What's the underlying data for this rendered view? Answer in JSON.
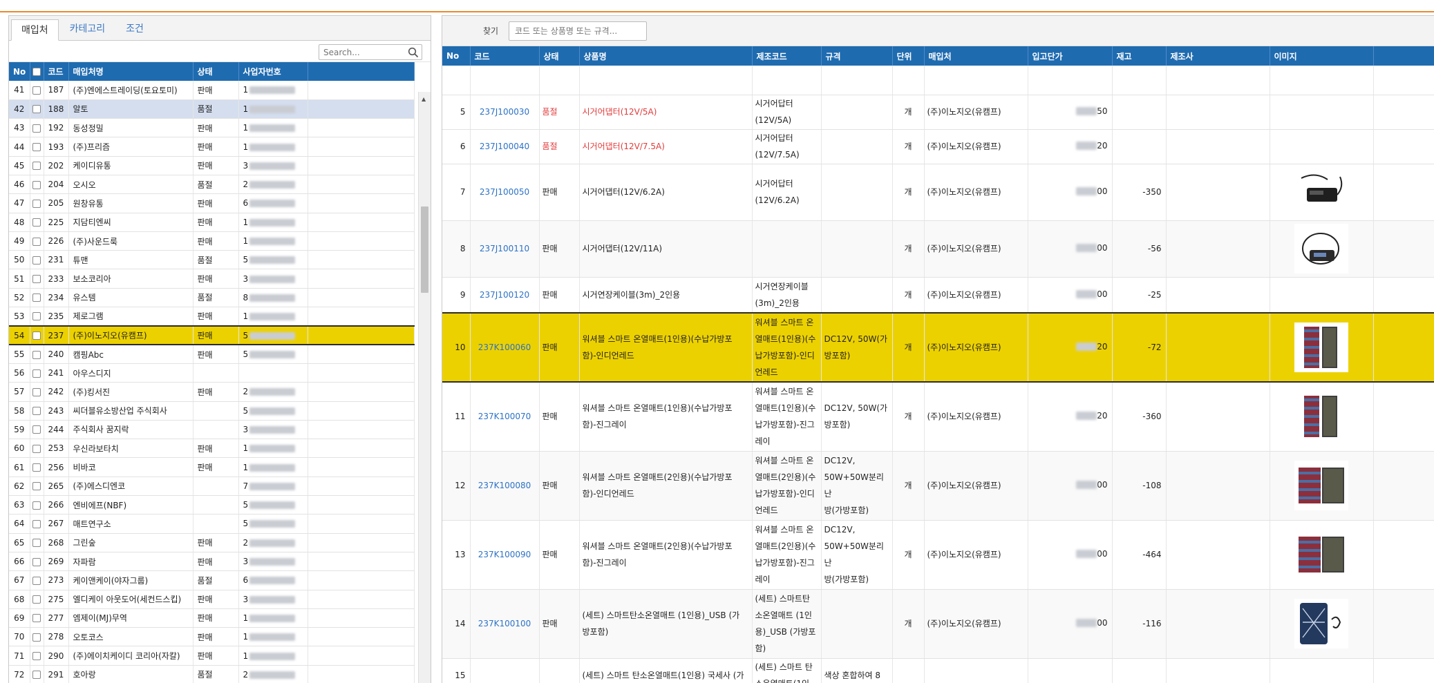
{
  "left": {
    "tabs": [
      "매입처",
      "카테고리",
      "조건"
    ],
    "search_placeholder": "Search...",
    "headers": [
      "No",
      "",
      "코드",
      "매입처명",
      "상태",
      "사업자번호"
    ],
    "rows": [
      {
        "no": "41",
        "code": "187",
        "name": "(주)엔에스트레이딩(토요토미)",
        "status": "판매",
        "biz": "1"
      },
      {
        "no": "42",
        "code": "188",
        "name": "알토",
        "status": "품절",
        "biz": "1"
      },
      {
        "no": "43",
        "code": "192",
        "name": "동성정밀",
        "status": "판매",
        "biz": "1"
      },
      {
        "no": "44",
        "code": "193",
        "name": "(주)프리즘",
        "status": "판매",
        "biz": "1"
      },
      {
        "no": "45",
        "code": "202",
        "name": "케이디유통",
        "status": "판매",
        "biz": "3"
      },
      {
        "no": "46",
        "code": "204",
        "name": "오시오",
        "status": "품절",
        "biz": "2"
      },
      {
        "no": "47",
        "code": "205",
        "name": "원창유통",
        "status": "판매",
        "biz": "6"
      },
      {
        "no": "48",
        "code": "225",
        "name": "지담티엔씨",
        "status": "판매",
        "biz": "1"
      },
      {
        "no": "49",
        "code": "226",
        "name": "(주)사운드룩",
        "status": "판매",
        "biz": "1"
      },
      {
        "no": "50",
        "code": "231",
        "name": "튜맨",
        "status": "품절",
        "biz": "5"
      },
      {
        "no": "51",
        "code": "233",
        "name": "보소코리아",
        "status": "판매",
        "biz": "3"
      },
      {
        "no": "52",
        "code": "234",
        "name": "유스템",
        "status": "품절",
        "biz": "8"
      },
      {
        "no": "53",
        "code": "235",
        "name": "제로그램",
        "status": "판매",
        "biz": "1"
      },
      {
        "no": "54",
        "code": "237",
        "name": "(주)이노지오(유캠프)",
        "status": "판매",
        "biz": "5"
      },
      {
        "no": "55",
        "code": "240",
        "name": "캠핑Abc",
        "status": "판매",
        "biz": "5"
      },
      {
        "no": "56",
        "code": "241",
        "name": "아우스디지",
        "status": "",
        "biz": ""
      },
      {
        "no": "57",
        "code": "242",
        "name": "(주)킹서진",
        "status": "판매",
        "biz": "2"
      },
      {
        "no": "58",
        "code": "243",
        "name": "씨더블유소방산업 주식회사",
        "status": "",
        "biz": "5"
      },
      {
        "no": "59",
        "code": "244",
        "name": "주식회사 꿈지락",
        "status": "",
        "biz": "3"
      },
      {
        "no": "60",
        "code": "253",
        "name": "우신라보타치",
        "status": "판매",
        "biz": "1"
      },
      {
        "no": "61",
        "code": "256",
        "name": "비바코",
        "status": "판매",
        "biz": "1"
      },
      {
        "no": "62",
        "code": "265",
        "name": "(주)에스디엔코",
        "status": "",
        "biz": "7"
      },
      {
        "no": "63",
        "code": "266",
        "name": "엔비에프(NBF)",
        "status": "",
        "biz": "5"
      },
      {
        "no": "64",
        "code": "267",
        "name": "매트연구소",
        "status": "",
        "biz": "5"
      },
      {
        "no": "65",
        "code": "268",
        "name": "그린숲",
        "status": "판매",
        "biz": "2"
      },
      {
        "no": "66",
        "code": "269",
        "name": "자파람",
        "status": "판매",
        "biz": "3"
      },
      {
        "no": "67",
        "code": "273",
        "name": "케이앤케이(야자그룹)",
        "status": "품절",
        "biz": "6"
      },
      {
        "no": "68",
        "code": "275",
        "name": "엘디케이 아웃도어(세컨드스킵)",
        "status": "판매",
        "biz": "3"
      },
      {
        "no": "69",
        "code": "277",
        "name": "엠제이(MJ)무역",
        "status": "판매",
        "biz": "1"
      },
      {
        "no": "70",
        "code": "278",
        "name": "오토코스",
        "status": "판매",
        "biz": "1"
      },
      {
        "no": "71",
        "code": "290",
        "name": "(주)에이치케이디 코리아(자칼)",
        "status": "판매",
        "biz": "1"
      },
      {
        "no": "72",
        "code": "291",
        "name": "호아랑",
        "status": "품절",
        "biz": "2"
      }
    ]
  },
  "right": {
    "find_label": "찾기",
    "find_placeholder": "코드 또는 상품명 또는 규격...",
    "headers": [
      "No",
      "코드",
      "상태",
      "상품명",
      "제조코드",
      "규격",
      "단위",
      "매입처",
      "입고단가",
      "재고",
      "제조사",
      "이미지"
    ],
    "rows": [
      {
        "no": "5",
        "code": "237J100030",
        "status": "품절",
        "name": "시거어댑터(12V/5A)",
        "mcode": "시거어답터\n(12V/5A)",
        "spec": "",
        "unit": "개",
        "vendor": "(주)이노지오(유캠프)",
        "price": "50",
        "stock": "",
        "maker": ""
      },
      {
        "no": "6",
        "code": "237J100040",
        "status": "품절",
        "name": "시거어댑터(12V/7.5A)",
        "mcode": "시거어답터\n(12V/7.5A)",
        "spec": "",
        "unit": "개",
        "vendor": "(주)이노지오(유캠프)",
        "price": "20",
        "stock": "",
        "maker": ""
      },
      {
        "no": "7",
        "code": "237J100050",
        "status": "판매",
        "name": "시거어댑터(12V/6.2A)",
        "mcode": "시거어답터\n(12V/6.2A)",
        "spec": "",
        "unit": "개",
        "vendor": "(주)이노지오(유캠프)",
        "price": "00",
        "stock": "-350",
        "maker": ""
      },
      {
        "no": "8",
        "code": "237J100110",
        "status": "판매",
        "name": "시거어댑터(12V/11A)",
        "mcode": "",
        "spec": "",
        "unit": "개",
        "vendor": "(주)이노지오(유캠프)",
        "price": "00",
        "stock": "-56",
        "maker": ""
      },
      {
        "no": "9",
        "code": "237J100120",
        "status": "판매",
        "name": "시거연장케이블(3m)_2인용",
        "mcode": "시거연장케이블\n(3m)_2인용",
        "spec": "",
        "unit": "개",
        "vendor": "(주)이노지오(유캠프)",
        "price": "00",
        "stock": "-25",
        "maker": ""
      },
      {
        "no": "10",
        "code": "237K100060",
        "status": "판매",
        "name": "워셔블 스마트 온열매트(1인용)(수납가방포\n함)-인디언레드",
        "mcode": "워셔블 스마트 온\n열매트(1인용)(수\n납가방포함)-인디\n언레드",
        "spec": "DC12V, 50W(가\n방포함)",
        "unit": "개",
        "vendor": "(주)이노지오(유캠프)",
        "price": "20",
        "stock": "-72",
        "maker": ""
      },
      {
        "no": "11",
        "code": "237K100070",
        "status": "판매",
        "name": "워셔블 스마트 온열매트(1인용)(수납가방포\n함)-진그레이",
        "mcode": "워셔블 스마트 온\n열매트(1인용)(수\n납가방포함)-진그\n레이",
        "spec": "DC12V, 50W(가\n방포함)",
        "unit": "개",
        "vendor": "(주)이노지오(유캠프)",
        "price": "20",
        "stock": "-360",
        "maker": ""
      },
      {
        "no": "12",
        "code": "237K100080",
        "status": "판매",
        "name": "워셔블 스마트 온열매트(2인용)(수납가방포\n함)-인디언레드",
        "mcode": "워셔블 스마트 온\n열매트(2인용)(수\n납가방포함)-인디\n언레드",
        "spec": "DC12V,\n50W+50W분리난\n방(가방포함)",
        "unit": "개",
        "vendor": "(주)이노지오(유캠프)",
        "price": "00",
        "stock": "-108",
        "maker": ""
      },
      {
        "no": "13",
        "code": "237K100090",
        "status": "판매",
        "name": "워셔블 스마트 온열매트(2인용)(수납가방포\n함)-진그레이",
        "mcode": "워셔블 스마트 온\n열매트(2인용)(수\n납가방포함)-진그\n레이",
        "spec": "DC12V,\n50W+50W분리난\n방(가방포함)",
        "unit": "개",
        "vendor": "(주)이노지오(유캠프)",
        "price": "00",
        "stock": "-464",
        "maker": ""
      },
      {
        "no": "14",
        "code": "237K100100",
        "status": "판매",
        "name": "(세트) 스마트탄소온열매트 (1인용)_USB (가\n방포함)",
        "mcode": "(세트) 스마트탄\n소온열매트 (1인\n용)_USB (가방포\n함)",
        "spec": "",
        "unit": "개",
        "vendor": "(주)이노지오(유캠프)",
        "price": "00",
        "stock": "-116",
        "maker": ""
      },
      {
        "no": "15",
        "code": "",
        "status": "",
        "name": "(세트) 스마트 탄소온열매트(1인용) 국세사 (가",
        "mcode": "(세트) 스마트 탄\n소온열매트(1인",
        "spec": "색상 혼합하여 8",
        "unit": "",
        "vendor": "",
        "price": "",
        "stock": "",
        "maker": ""
      }
    ]
  }
}
